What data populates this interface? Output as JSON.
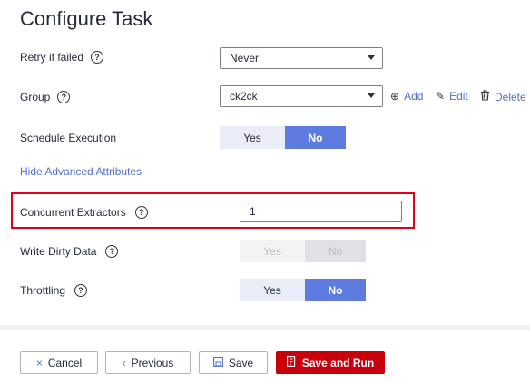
{
  "title": "Configure Task",
  "retry": {
    "label": "Retry if failed",
    "value": "Never"
  },
  "group": {
    "label": "Group",
    "value": "ck2ck",
    "add": "Add",
    "edit": "Edit",
    "delete": "Delete"
  },
  "schedule": {
    "label": "Schedule Execution",
    "yes": "Yes",
    "no": "No",
    "selected": "No"
  },
  "advanced_link": "Hide Advanced Attributes",
  "concurrent": {
    "label": "Concurrent Extractors",
    "value": "1"
  },
  "dirty": {
    "label": "Write Dirty Data",
    "yes": "Yes",
    "no": "No",
    "selected": "No",
    "disabled": true
  },
  "throttling": {
    "label": "Throttling",
    "yes": "Yes",
    "no": "No",
    "selected": "No"
  },
  "footer": {
    "cancel": "Cancel",
    "previous": "Previous",
    "save": "Save",
    "save_run": "Save and Run"
  },
  "help_glyph": "?",
  "accent_color": "#5e7ce0",
  "primary_color": "#c7000b",
  "highlight_color": "#e0001b"
}
